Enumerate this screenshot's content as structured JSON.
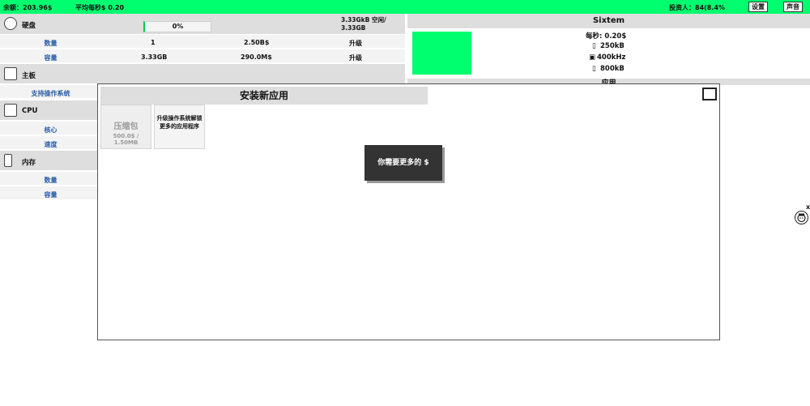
{
  "topbar": {
    "balance": "余额：203.96$",
    "avg_per_sec": "平均每秒$ 0.20",
    "investors": "投资人：84(8.4%",
    "settings_label": "设置",
    "sound_label": "声音"
  },
  "disk": {
    "title": "硬盘",
    "progress": "0%",
    "progress_fraction": 0.0,
    "space": "3.33GkB 空闲/ 3.33GB",
    "rows": [
      {
        "key": "数量",
        "v1": "1",
        "v2": "2.50B$",
        "action": "升级"
      },
      {
        "key": "容量",
        "v1": "3.33GB",
        "v2": "290.0M$",
        "action": "升级"
      }
    ]
  },
  "motherboard": {
    "title": "主板",
    "rows": [
      {
        "key": "支持操作系统"
      }
    ]
  },
  "cpu": {
    "title": "CPU",
    "rows": [
      {
        "key": "核心"
      },
      {
        "key": "速度"
      }
    ]
  },
  "memory": {
    "title": "内存",
    "rows": [
      {
        "key": "数量"
      },
      {
        "key": "容量"
      }
    ]
  },
  "system": {
    "title": "Sixtem",
    "per_sec": "每秒: 0.20$",
    "storage": "250kB",
    "clock": "400kHz",
    "mem": "800kB",
    "accent": "#00ff6e",
    "section2_title": "应用"
  },
  "modal": {
    "title": "安装新应用",
    "app1_name": "压缩包",
    "app1_price": "500.0$ / 1.50MB",
    "app2_text_l1": "升级操作系统解锁",
    "app2_text_l2": "更多的应用程序",
    "notice": "你需要更多的 $"
  },
  "avatar": {
    "close": "x"
  }
}
